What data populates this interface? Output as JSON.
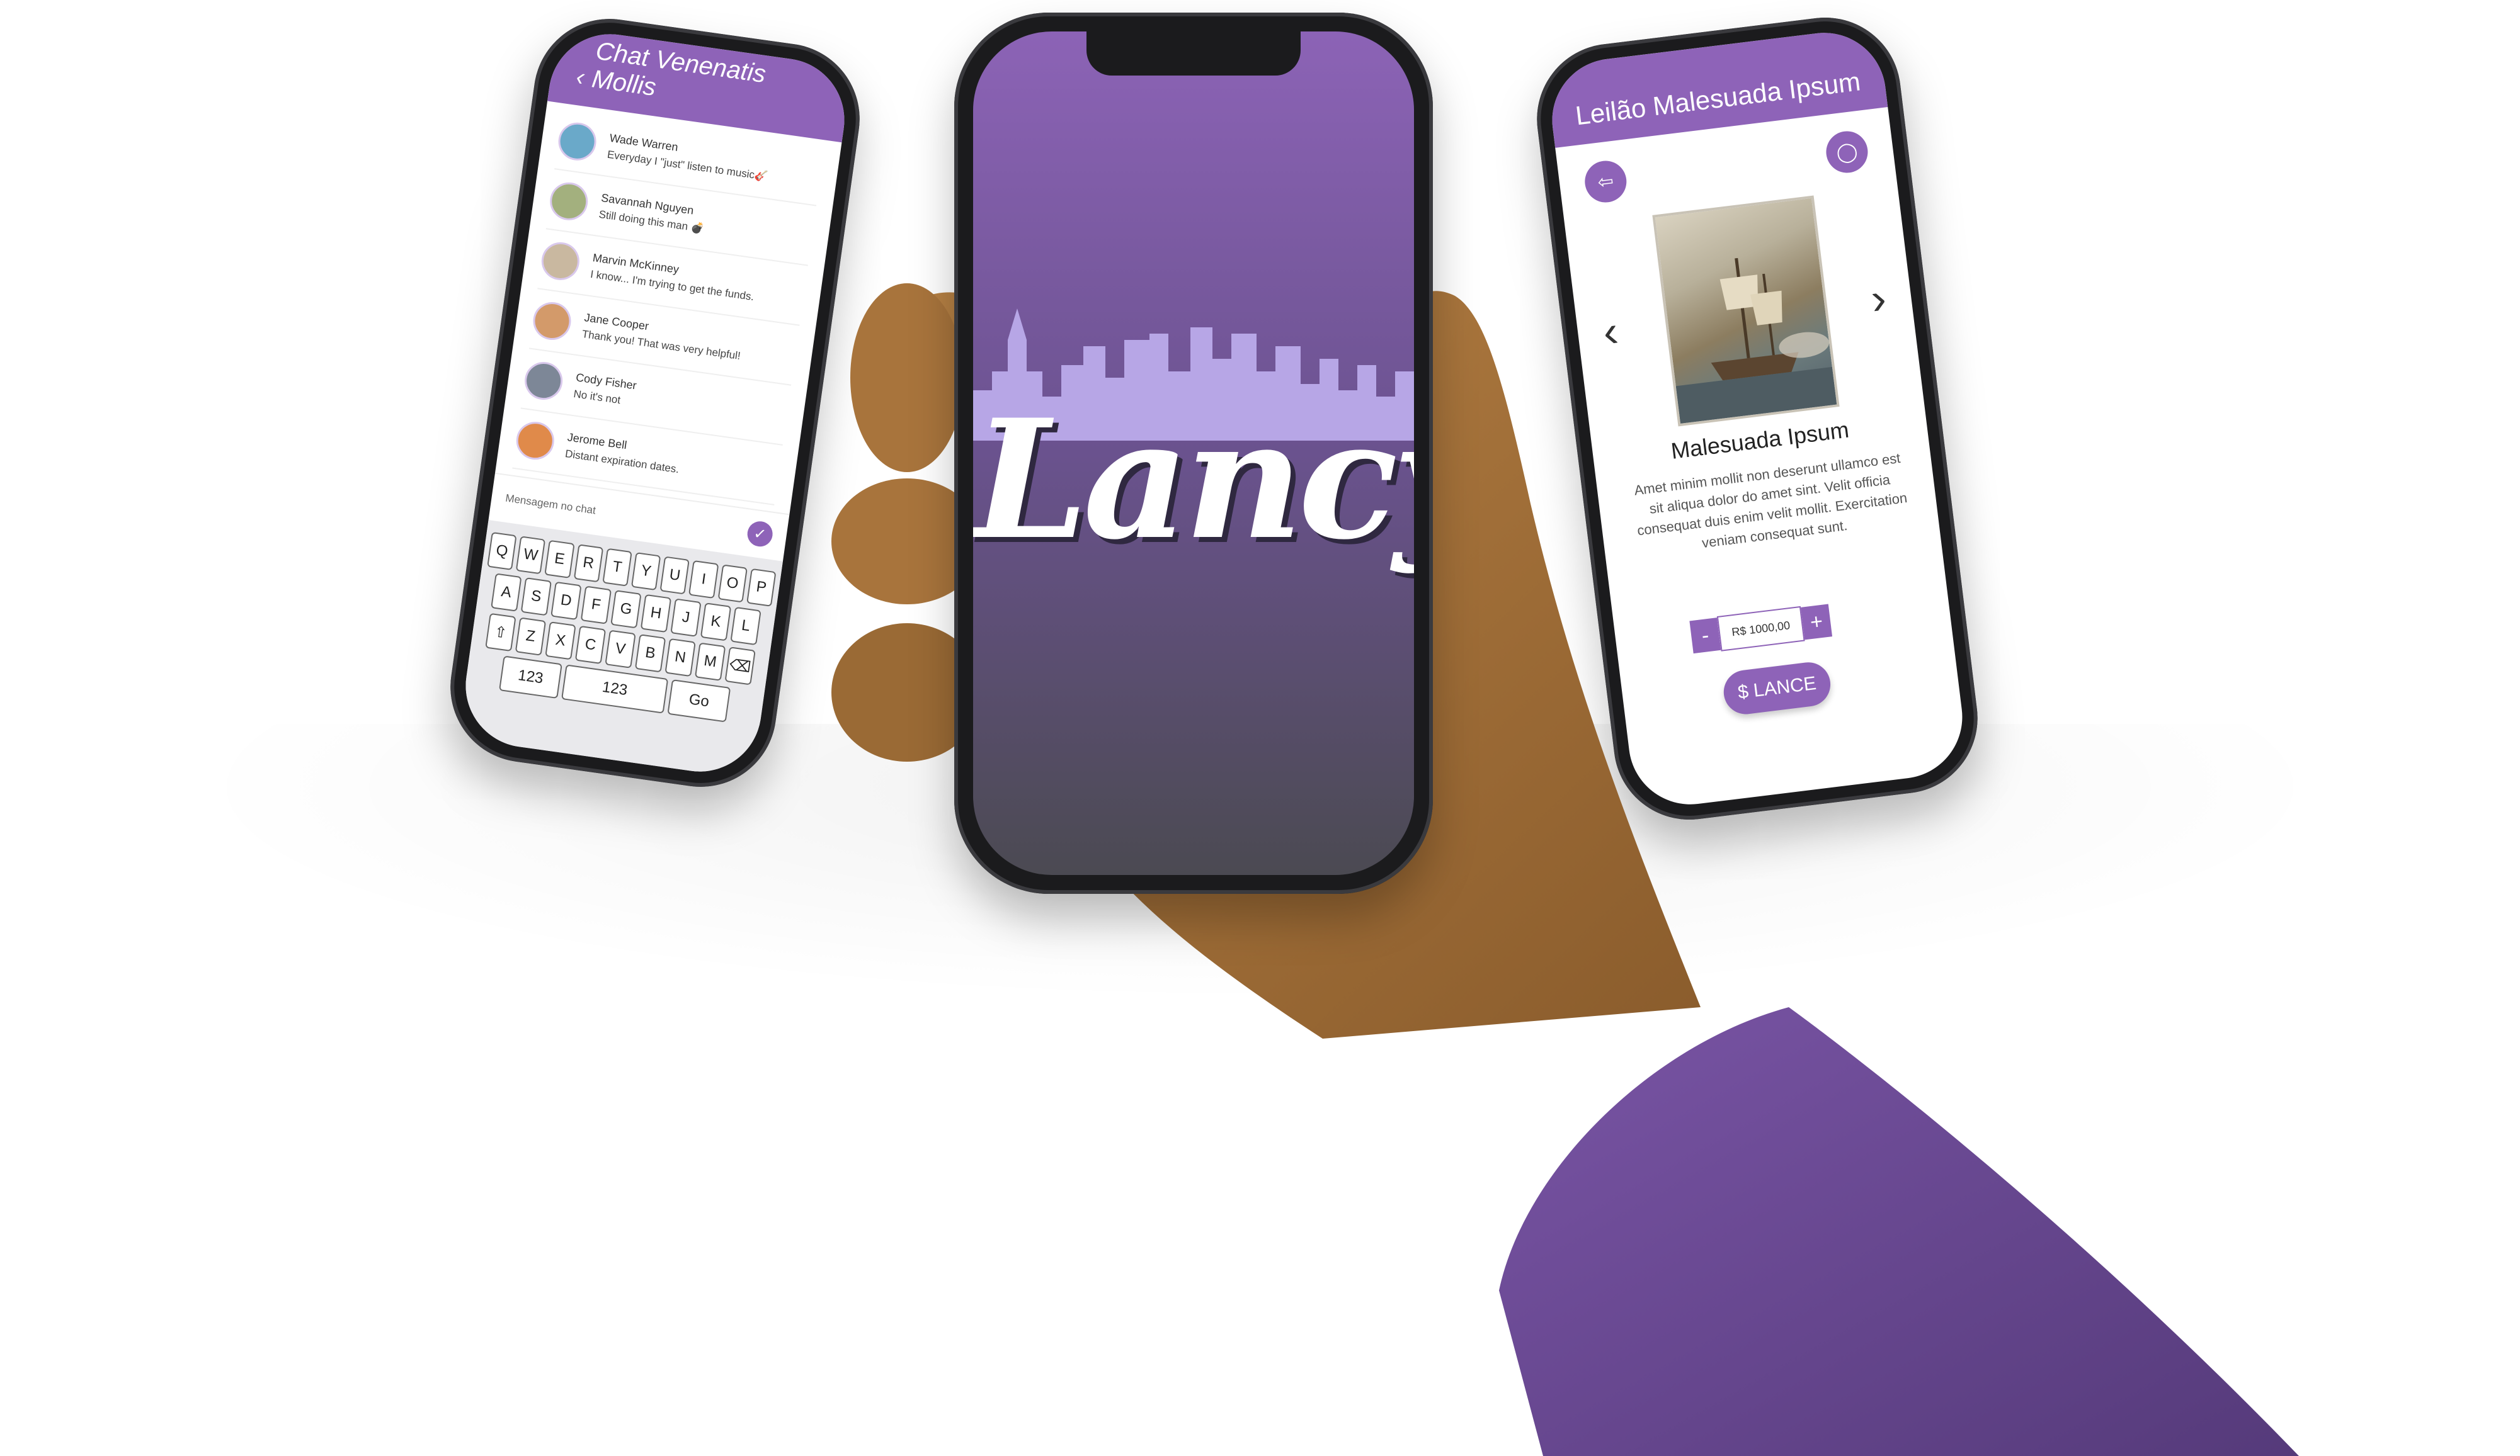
{
  "colors": {
    "accent": "#8e63b8",
    "background": "#ffffff",
    "skin": "#a9773f",
    "sleeve": "#6c4a93"
  },
  "chat": {
    "title": "Chat Venenatis Mollis",
    "back_icon": "chevron-left-icon",
    "items": [
      {
        "name": "Wade Warren",
        "message": "Everyday I \"just\" listen to music🎸"
      },
      {
        "name": "Savannah Nguyen",
        "message": "Still doing this man 💣"
      },
      {
        "name": "Marvin McKinney",
        "message": "I know... I'm trying to get the funds."
      },
      {
        "name": "Jane Cooper",
        "message": "Thank you! That was very helpful!"
      },
      {
        "name": "Cody Fisher",
        "message": "No it's not"
      },
      {
        "name": "Jerome Bell",
        "message": "Distant expiration dates."
      }
    ],
    "input_placeholder": "Mensagem no chat",
    "send_icon": "check-icon",
    "keyboard": {
      "row1": [
        "Q",
        "W",
        "E",
        "R",
        "T",
        "Y",
        "U",
        "I",
        "O",
        "P"
      ],
      "row2": [
        "A",
        "S",
        "D",
        "F",
        "G",
        "H",
        "J",
        "K",
        "L"
      ],
      "row3": [
        "⇧",
        "Z",
        "X",
        "C",
        "V",
        "B",
        "N",
        "M",
        "⌫"
      ],
      "row4": [
        "123",
        "123",
        "Go"
      ]
    }
  },
  "splash": {
    "logo": "Lancy"
  },
  "auction": {
    "title": "Leilão Malesuada Ipsum",
    "back_icon": "exit-icon",
    "chat_icon": "chat-bubble-icon",
    "prev_icon": "chevron-left-icon",
    "next_icon": "chevron-right-icon",
    "item_title": "Malesuada Ipsum",
    "description": "Amet minim mollit non deserunt ullamco est sit aliqua dolor do amet sint. Velit officia consequat duis enim velit mollit. Exercitation veniam consequat sunt.",
    "minus": "-",
    "bid_value": "R$ 1000,00",
    "plus": "+",
    "bid_button": "$ LANCE"
  }
}
